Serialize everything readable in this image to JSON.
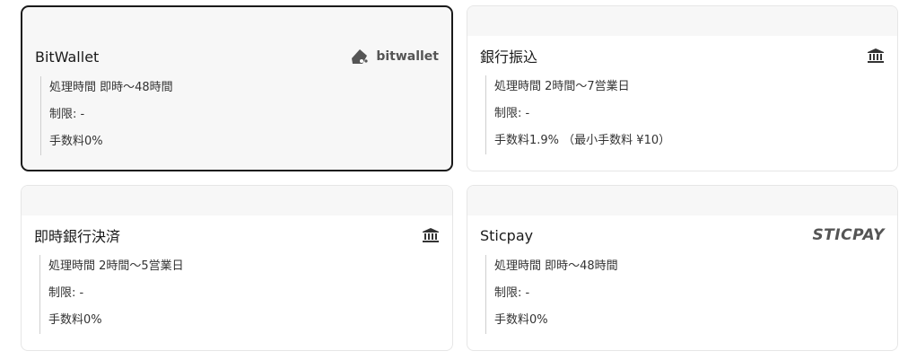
{
  "methods": [
    {
      "title": "BitWallet",
      "brand": "bitwallet",
      "icon": "bitwallet-logo-icon",
      "processing": "処理時間 即時〜48時間",
      "limit": "制限: -",
      "fee": "手数料0%",
      "selected": true
    },
    {
      "title": "銀行振込",
      "icon": "bank-icon",
      "processing": "処理時間 2時間〜7営業日",
      "limit": "制限: -",
      "fee": "手数料1.9% （最小手数料 ¥10）",
      "selected": false
    },
    {
      "title": "即時銀行決済",
      "icon": "bank-icon",
      "processing": "処理時間 2時間〜5営業日",
      "limit": "制限: -",
      "fee": "手数料0%",
      "selected": false
    },
    {
      "title": "Sticpay",
      "brand": "STICPAY",
      "icon": "sticpay-logo-icon",
      "processing": "処理時間 即時〜48時間",
      "limit": "制限: -",
      "fee": "手数料0%",
      "selected": false
    }
  ]
}
